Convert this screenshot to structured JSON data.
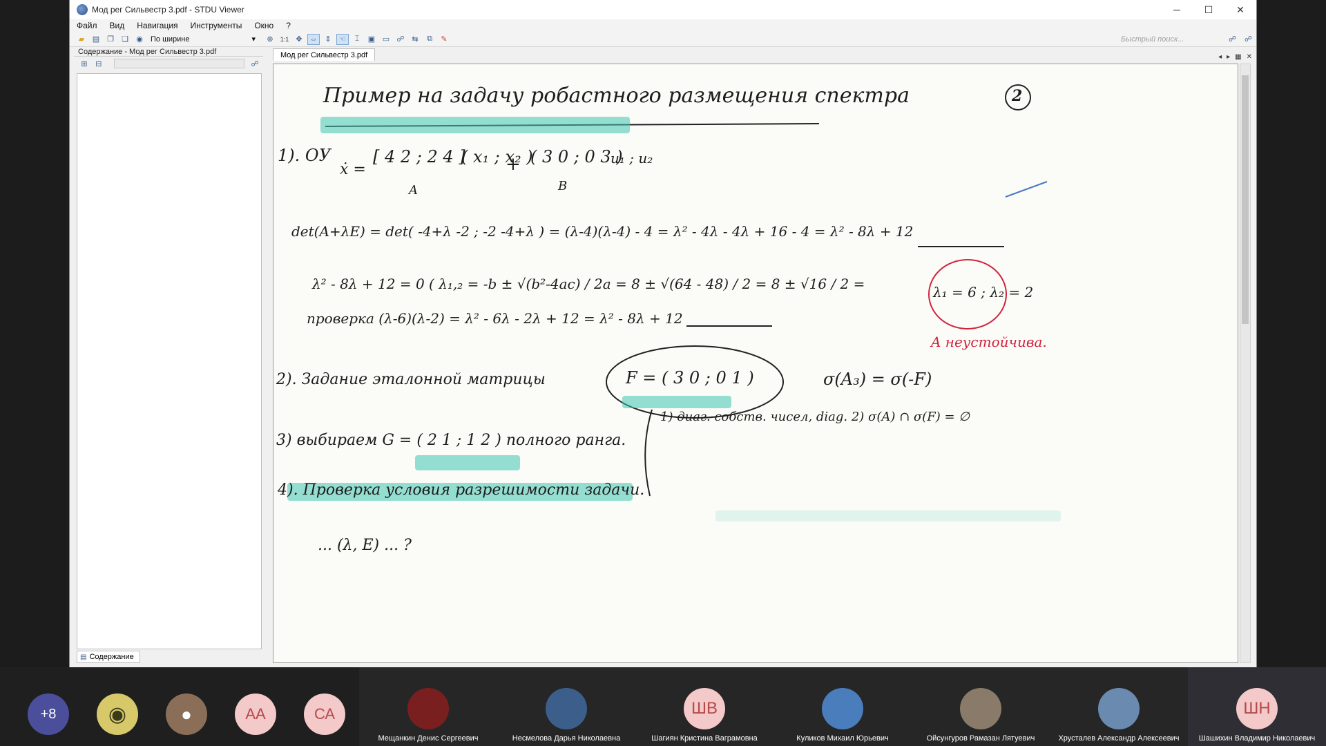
{
  "window": {
    "title": "Мод рег Сильвестр 3.pdf - STDU Viewer",
    "controls": [
      "─",
      "☐",
      "✕"
    ]
  },
  "menu": [
    "Файл",
    "Вид",
    "Навигация",
    "Инструменты",
    "Окно",
    "?"
  ],
  "toolbar": {
    "zoom_mode": "По ширине",
    "one_to_one": "1:1",
    "quick_search_placeholder": "Быстрый поиск..."
  },
  "left_panel": {
    "header": "Содержание - Мод рег Сильвестр 3.pdf",
    "tab": "Содержание"
  },
  "document": {
    "tab": "Мод рег Сильвестр 3.pdf",
    "page_badge": "2",
    "lines": {
      "title": "Пример на задачу робастного размещения спектра",
      "s1": "1). ОУ",
      "xdot": "ẋ =",
      "matA": "[ 4  2 ; 2  4 ]",
      "vecx": "( x₁ ; x₂ )",
      "plus": "+",
      "matB": "( 3  0 ; 0  3 )",
      "vecu": "u₁ ; u₂",
      "labA": "A",
      "labB": "B",
      "det": "det(A+λE) = det( -4+λ  -2 ; -2  -4+λ ) = (λ-4)(λ-4) - 4 = λ² - 4λ - 4λ + 16 - 4 = λ² - 8λ + 12",
      "quad": "λ² - 8λ + 12 = 0 (   λ₁,₂ = -b ± √(b²-4ac) / 2a  =  8 ± √(64 - 48) / 2  =  8 ± √16 / 2  =",
      "roots": "λ₁ = 6 ; λ₂ = 2",
      "unstable": "A неустойчива.",
      "check": "проверка  (λ-6)(λ-2) = λ² - 6λ - 2λ + 12 = λ² - 8λ + 12",
      "s2": "2). Задание эталонной матрицы",
      "matF": "F = ( 3  0 ; 0  1 )",
      "spectra": "σ(A₃) = σ(-F)",
      "cond": "1) диаг. собств. чисел, diag.   2) σ(A) ∩ σ(F) = ∅",
      "s3": "3) выбираем G = ( 2  1 ; 1  2 )  полного ранга.",
      "s4": "4). Проверка условия разрешимости задачи.",
      "s5": "... (λ, E) ... ?"
    }
  },
  "participants": {
    "more": "+8",
    "avatars": [
      {
        "kind": "emoji"
      },
      {
        "kind": "photo"
      },
      {
        "initials": "АА",
        "color": "#f3c9c9"
      },
      {
        "initials": "СА",
        "color": "#f3c9c9"
      }
    ],
    "tiles": [
      {
        "name": "Мещанкин Денис Сергеевич",
        "initials": "",
        "color": "#7a1f1f"
      },
      {
        "name": "Несмелова Дарья Николаевна",
        "initials": "",
        "color": "#3b5f8a"
      },
      {
        "name": "Шагиян Кристина Ваграмовна",
        "initials": "ШВ",
        "color": "#f3c9c9"
      },
      {
        "name": "Куликов Михаил Юрьевич",
        "initials": "",
        "color": "#4a7dbb"
      },
      {
        "name": "Ойсунгуров Рамазан Лятуевич",
        "initials": "",
        "color": "#8a7a6a"
      },
      {
        "name": "Хрусталев Александр Алексеевич",
        "initials": "",
        "color": "#6a8ab0"
      },
      {
        "name": "Шашихин Владимир Николаевич",
        "initials": "ШН",
        "color": "#f3c9c9"
      }
    ]
  }
}
